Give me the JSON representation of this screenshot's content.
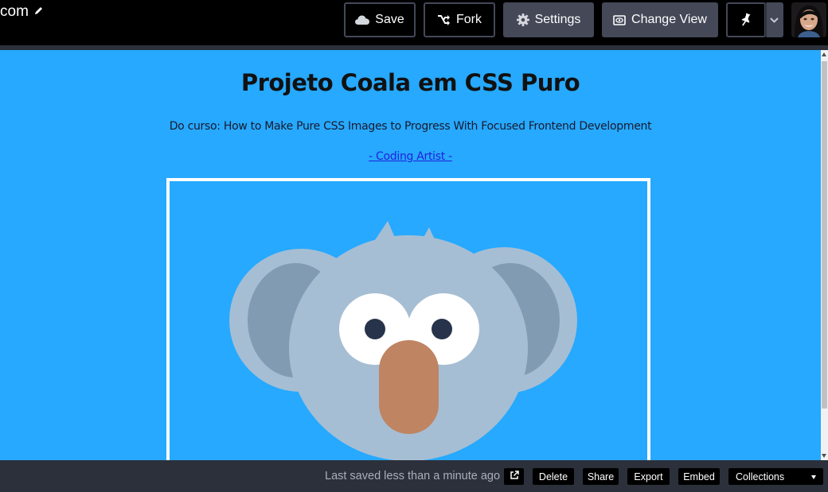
{
  "header": {
    "title": "com",
    "buttons": {
      "save": "Save",
      "fork": "Fork",
      "settings": "Settings",
      "change_view": "Change View"
    }
  },
  "preview": {
    "title": "Projeto Coala em CSS Puro",
    "course": "Do curso: How to Make Pure CSS Images to Progress With Focused Frontend Development",
    "author": "- Coding Artist -"
  },
  "footer": {
    "saved_status": "Last saved less than a minute ago",
    "buttons": {
      "delete": "Delete",
      "share": "Share",
      "export": "Export",
      "embed": "Embed",
      "collections": "Collections"
    }
  },
  "colors": {
    "preview_background": "#26a9ff",
    "koala_face": "#a6bed4",
    "koala_inner_ear": "#819cb2",
    "koala_nose": "#bf8462",
    "koala_pupil": "#27334a",
    "toolbar_button": "#444857"
  },
  "icons": [
    "pencil-icon",
    "cloud-icon",
    "fork-icon",
    "gear-icon",
    "eye-icon",
    "pin-icon",
    "chevron-down-icon",
    "external-link-icon"
  ]
}
